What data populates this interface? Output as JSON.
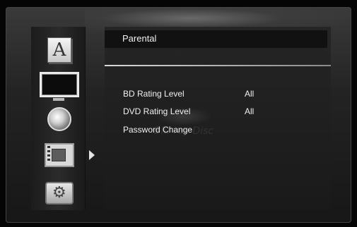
{
  "menu": {
    "title": "Parental",
    "items": [
      {
        "label": "BD Rating Level",
        "value": "All"
      },
      {
        "label": "DVD Rating Level",
        "value": "All"
      },
      {
        "label": "Password Change",
        "value": ""
      }
    ]
  },
  "sidebar": {
    "icons": [
      "language-icon",
      "display-icon",
      "audio-icon",
      "parental-icon",
      "system-icon"
    ],
    "icon_a_glyph": "A"
  },
  "watermark": {
    "text": "Blu-ray Disc"
  }
}
